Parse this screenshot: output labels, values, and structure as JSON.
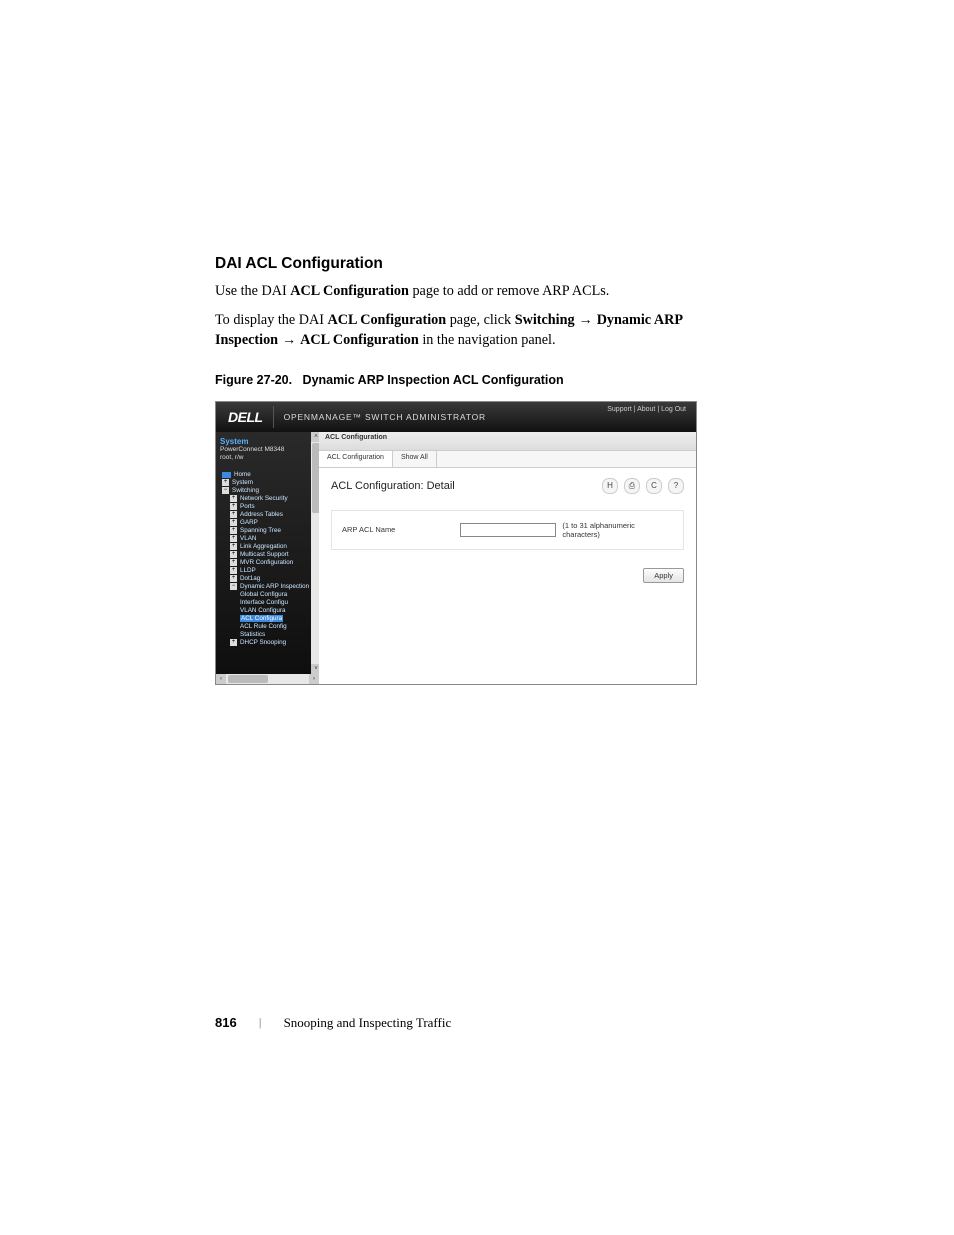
{
  "section_heading": "DAI ACL Configuration",
  "intro_line_1_prefix": "Use the DAI ",
  "intro_line_1_bold": "ACL Configuration",
  "intro_line_1_suffix": " page to add or remove ARP ACLs.",
  "intro_line_2_prefix": "To display the DAI ",
  "intro_line_2_bold1": "ACL Configuration",
  "intro_line_2_mid": " page, click ",
  "intro_line_2_bold2": "Switching",
  "intro_line_2_arrow1": " → ",
  "intro_line_2_bold3": "Dynamic ARP Inspection",
  "intro_line_2_arrow2": " → ",
  "intro_line_2_bold4": "ACL Configuration",
  "intro_line_2_suffix": " in the navigation panel.",
  "figure_caption_num": "Figure 27-20.",
  "figure_caption_title": "Dynamic ARP Inspection ACL Configuration",
  "shot": {
    "brand": "DELL",
    "header_title": "OPENMANAGE™ SWITCH ADMINISTRATOR",
    "top_links": "Support  |  About  |  Log Out",
    "sidebar": {
      "system": "System",
      "device": "PowerConnect M8348",
      "user": "root, r/w",
      "tree": {
        "home": "Home",
        "system": "System",
        "switching": "Switching",
        "items": [
          "Network Security",
          "Ports",
          "Address Tables",
          "GARP",
          "Spanning Tree",
          "VLAN",
          "Link Aggregation",
          "Multicast Support",
          "MVR Configuration",
          "LLDP",
          "Dot1ag",
          "Dynamic ARP Inspection"
        ],
        "dai_children": [
          "Global Configura",
          "Interface Configu",
          "VLAN Configura"
        ],
        "dai_selected": "ACL Configura",
        "dai_after": [
          "ACL Rule Config",
          "Statistics"
        ],
        "dhcp": "DHCP Snooping"
      }
    },
    "crumb": "ACL Configuration",
    "tabs": {
      "active": "ACL Configuration",
      "other": "Show All"
    },
    "panel_title": "ACL Configuration: Detail",
    "icons": {
      "save": "H",
      "print": "⎙",
      "refresh": "C",
      "help": "?"
    },
    "field_label": "ARP ACL Name",
    "field_hint": "(1 to 31 alphanumeric characters)",
    "apply": "Apply"
  },
  "footer": {
    "page_number": "816",
    "chapter_title": "Snooping and Inspecting Traffic"
  }
}
